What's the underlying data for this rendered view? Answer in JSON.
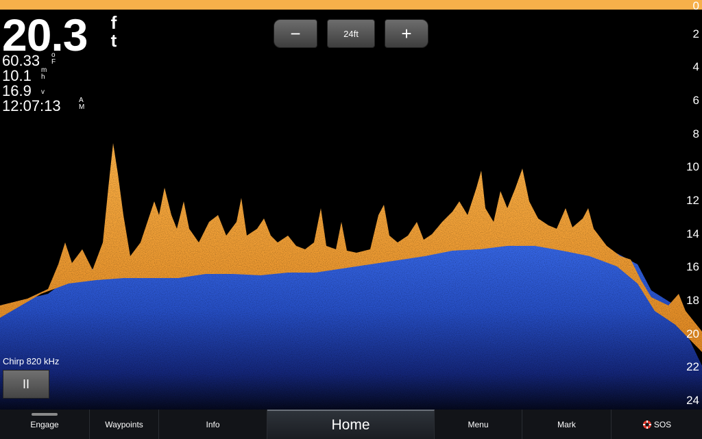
{
  "readouts": {
    "depth_value": "20.3",
    "depth_unit_1": "f",
    "depth_unit_2": "t",
    "temperature_value": "60.33",
    "temperature_unit_1": "o",
    "temperature_unit_2": "F",
    "speed_value": "10.1",
    "speed_unit_1": "m",
    "speed_unit_2": "h",
    "voltage_value": "16.9",
    "voltage_unit": "v",
    "time_value": "12:07:13",
    "time_unit_1": "A",
    "time_unit_2": "M"
  },
  "zoom": {
    "zoom_out_label": "−",
    "range_label": "24ft",
    "zoom_in_label": "+"
  },
  "depth_scale": [
    "0",
    "2",
    "4",
    "6",
    "8",
    "10",
    "12",
    "14",
    "16",
    "18",
    "20",
    "22",
    "24"
  ],
  "sonar": {
    "frequency_label": "Chirp 820 kHz",
    "pause_label": "II"
  },
  "bottom_bar": {
    "engage": "Engage",
    "waypoints": "Waypoints",
    "info": "Info",
    "home": "Home",
    "menu": "Menu",
    "mark": "Mark",
    "sos": "SOS"
  },
  "colors": {
    "top_strip": "#f6b04a",
    "sonar_strong": "#f5a53c",
    "sonar_weak": "#2b5bd8",
    "background": "#000000"
  },
  "icons": {
    "sos": "sos-lifebuoy-icon"
  }
}
